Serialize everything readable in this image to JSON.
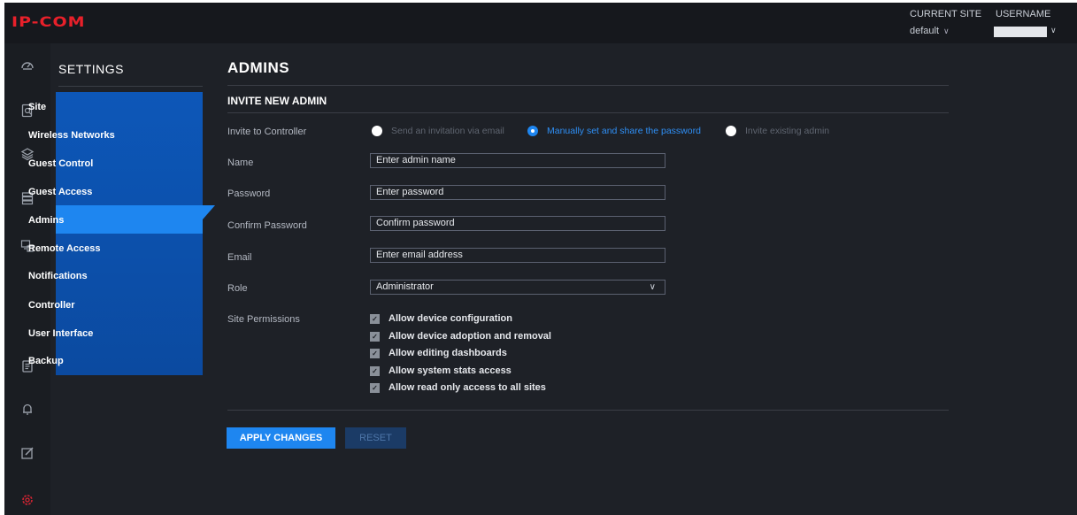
{
  "brand": {
    "logo": "IP-COM",
    "logo_color": "#e8202a"
  },
  "header": {
    "current_site_label": "CURRENT SITE",
    "username_label": "USERNAME",
    "current_site_value": "default"
  },
  "rail": {
    "icons": [
      "dashboard-icon",
      "statistics-icon",
      "map-layers-icon",
      "devices-icon",
      "topology-icon",
      "logs-icon",
      "alerts-icon",
      "edit-icon",
      "settings-icon"
    ],
    "active": "settings-icon"
  },
  "settings": {
    "title": "SETTINGS",
    "menu": [
      "Site",
      "Wireless Networks",
      "Guest Control",
      "Guest Access",
      "Admins",
      "Remote Access",
      "Notifications",
      "Controller",
      "User Interface",
      "Backup"
    ],
    "active": "Admins"
  },
  "main": {
    "title": "ADMINS",
    "section": "INVITE NEW ADMIN",
    "invite": {
      "label": "Invite to Controller",
      "options": [
        "Send an invitation via email",
        "Manually set and share the password",
        "Invite existing admin"
      ],
      "selected": "Manually set and share the password"
    },
    "name": {
      "label": "Name",
      "value": "Enter admin name"
    },
    "password": {
      "label": "Password",
      "value": "Enter password"
    },
    "confirm": {
      "label": "Confirm Password",
      "value": "Confirm password"
    },
    "email": {
      "label": "Email",
      "value": "Enter email address"
    },
    "role": {
      "label": "Role",
      "value": "Administrator"
    },
    "permissions": {
      "label": "Site Permissions",
      "items": [
        "Allow device configuration",
        "Allow device adoption and removal",
        "Allow editing dashboards",
        "Allow system stats access",
        "Allow read only access to all sites"
      ]
    },
    "apply": "APPLY CHANGES",
    "reset": "RESET"
  },
  "colors": {
    "accent": "#1e86f0",
    "menu_bg": "#0d57b8",
    "bg": "#1e2127"
  }
}
